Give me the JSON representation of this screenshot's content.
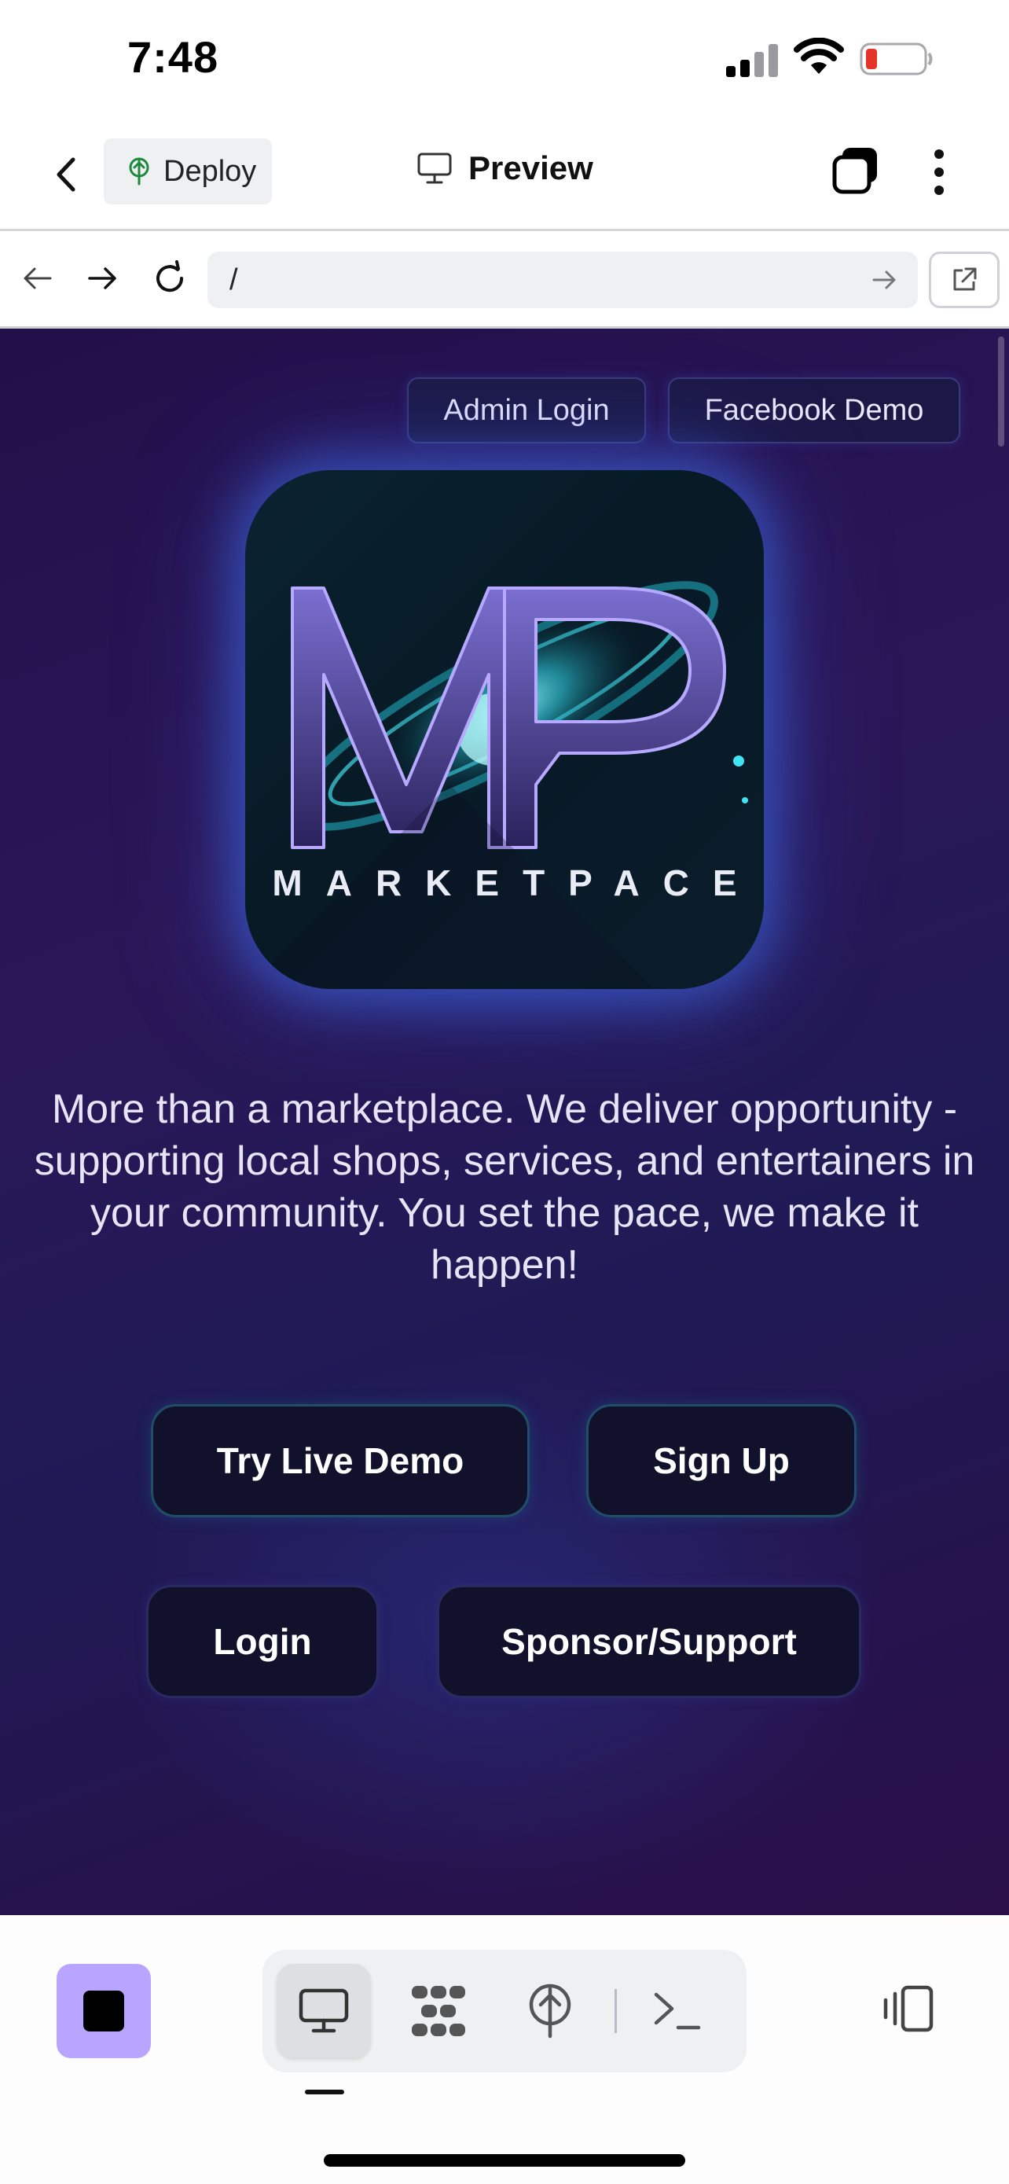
{
  "status_bar": {
    "time": "7:48",
    "icons": [
      "cellular-signal-icon",
      "wifi-icon",
      "battery-low-icon"
    ],
    "battery_color": "#e5332a"
  },
  "header": {
    "back_icon": "chevron-left-icon",
    "deploy_label": "Deploy",
    "deploy_icon": "deploy-antenna-icon",
    "title": "Preview",
    "title_icon": "monitor-icon",
    "tabs_icon": "tabs-stack-icon",
    "more_icon": "more-vertical-icon"
  },
  "browser": {
    "url": "/",
    "icons": [
      "arrow-left-icon",
      "arrow-right-icon",
      "refresh-icon",
      "url-go-icon",
      "external-link-icon"
    ]
  },
  "page": {
    "top_buttons": [
      "Admin Login",
      "Facebook Demo"
    ],
    "logo_wordmark": "MARKETPACE",
    "tagline": "More than a marketplace. We deliver opportunity - supporting local shops, services, and entertainers in your community. You set the pace, we make it happen!",
    "ctas": {
      "try_demo": "Try Live Demo",
      "sign_up": "Sign Up",
      "login": "Login",
      "sponsor": "Sponsor/Support"
    },
    "accent_color": "#1f4e66",
    "background_color": "#2b1758"
  },
  "toolbar": {
    "stop_color": "#b9a5ff",
    "tools": [
      "monitor-icon",
      "workflows-icon",
      "deploy-antenna-icon",
      "terminal-icon"
    ],
    "active_tool": "monitor-icon",
    "panel_icon": "panel-toggle-icon"
  }
}
